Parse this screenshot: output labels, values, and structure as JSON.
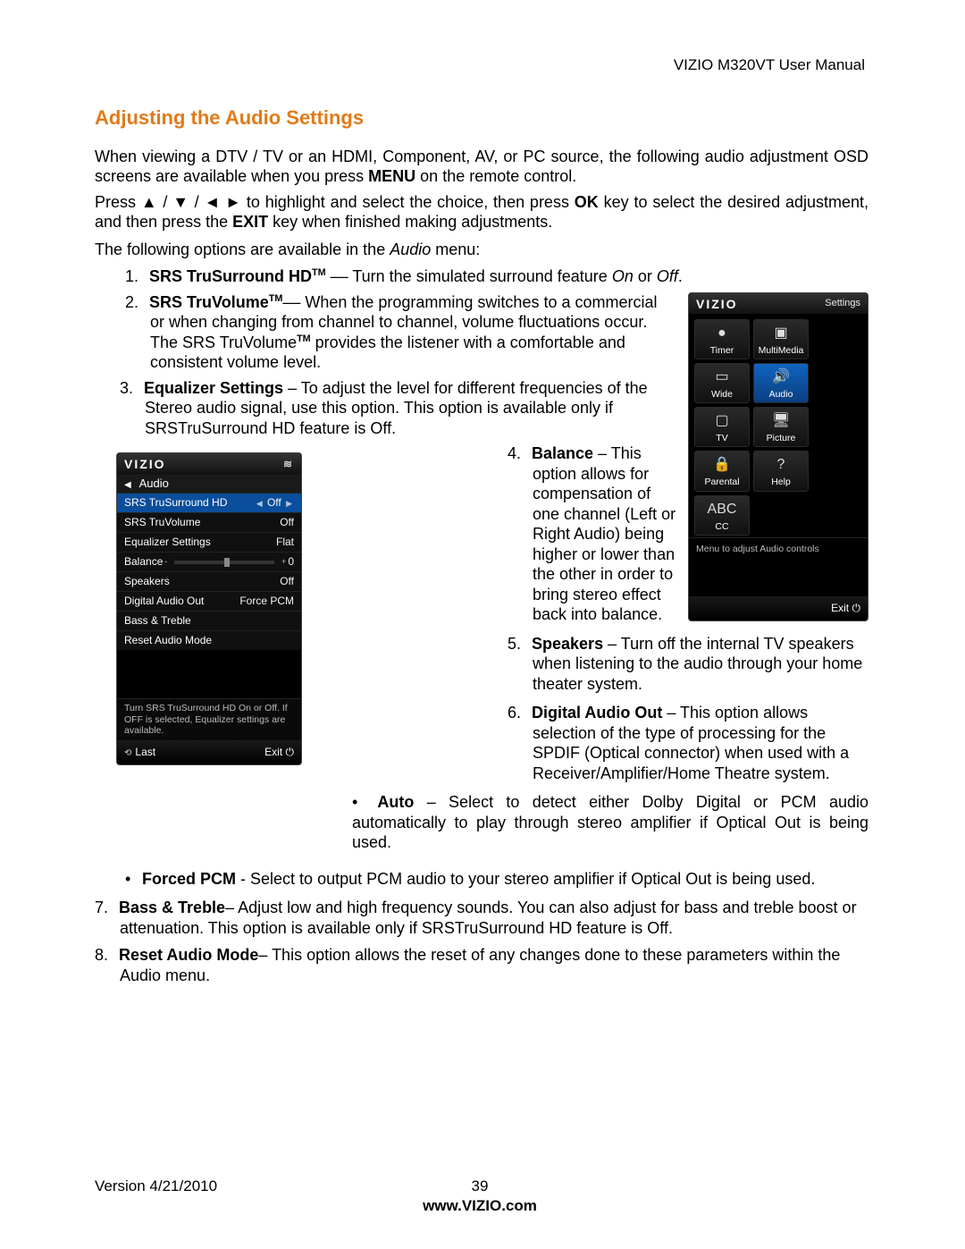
{
  "doc": {
    "header": "VIZIO M320VT User Manual",
    "title": "Adjusting the Audio Settings",
    "intro1a": "When viewing a DTV / TV or an HDMI, Component, AV, or PC source, the following audio adjustment OSD screens are available when you press ",
    "intro1b": "MENU",
    "intro1c": " on the remote control.",
    "intro2a": "Press  ▲  /  ▼  /  ◄    ►  to highlight and select the choice, then press ",
    "intro2b": "OK",
    "intro2c": " key to select the desired adjustment, and then press the ",
    "intro2d": "EXIT",
    "intro2e": " key when finished making adjustments.",
    "intro3a": "The following options are available in the ",
    "intro3b": "Audio",
    "intro3c": " menu:",
    "li1": {
      "n": "1.",
      "b": "SRS TruSurround HD",
      "tm": "TM",
      "dash": " –– ",
      "t": "Turn the simulated surround feature ",
      "i1": "On",
      "mid": " or ",
      "i2": "Off",
      "end": "."
    },
    "li2": {
      "n": "2.",
      "b": "SRS TruVolume",
      "tm": "TM",
      "dash": "–– ",
      "t": "When the programming switches to a commercial or when changing from channel to channel, volume fluctuations occur. The SRS TruVolume",
      "tm2": "TM",
      "t2": "  provides the listener with a comfortable and consistent volume level."
    },
    "li3": {
      "n": "3.",
      "b": "Equalizer Settings",
      "dash": " – ",
      "t": "To adjust the level for different frequencies of the Stereo audio signal, use this option. This option is available only if SRSTruSurround HD feature is Off."
    },
    "li4": {
      "n": "4.",
      "b": "Balance",
      "dash": " – ",
      "t": "This option allows for compensation of one channel (Left or Right Audio) being higher or lower than the other in order to bring stereo effect back into balance."
    },
    "li5": {
      "n": "5.",
      "b": "Speakers",
      "dash": " – ",
      "t": "Turn off the internal TV speakers when listening to the audio through your home theater system."
    },
    "li6": {
      "n": "6.",
      "b": "Digital Audio Out",
      "dash": " – ",
      "t": "This option allows selection of the type of processing for the SPDIF (Optical connector) when used with a Receiver/Amplifier/Home Theatre system."
    },
    "li6a": {
      "b": "Auto",
      "dash": " – ",
      "t": "Select to detect either Dolby Digital or PCM audio automatically to play through stereo amplifier if Optical Out is being used."
    },
    "li6b": {
      "b": "Forced PCM",
      "dash": " - ",
      "t": "Select to output PCM audio to your stereo amplifier if Optical Out is being used."
    },
    "li7": {
      "n": " 7.",
      "b": "Bass & Treble",
      "dash": "– ",
      "t": "Adjust low and high frequency sounds. You can also adjust for bass and treble boost or attenuation. This option is available only if SRSTruSurround HD feature is Off."
    },
    "li8": {
      "n": "8.",
      "b": "Reset Audio ",
      "b2": "Mode",
      "dash": "– ",
      "t": "This option allows the reset of any changes done to these parameters within the Audio menu."
    },
    "footer": {
      "version": "Version 4/21/2010",
      "page": "39",
      "site": "www.VIZIO.com"
    }
  },
  "osd_audio": {
    "brand": "VIZIO",
    "wifi": "≋",
    "subtitle": "Audio",
    "tri": "◀",
    "rows": [
      {
        "label": "SRS TruSurround HD",
        "value": "Off",
        "sel": true,
        "arrows": true
      },
      {
        "label": "SRS TruVolume",
        "value": "Off"
      },
      {
        "label": "Equalizer Settings",
        "value": "Flat"
      },
      {
        "label": "Balance",
        "value": "0",
        "slider": true
      },
      {
        "label": "Speakers",
        "value": "Off"
      },
      {
        "label": "Digital Audio Out",
        "value": "Force PCM"
      },
      {
        "label": "Bass & Treble",
        "value": ""
      },
      {
        "label": "Reset Audio Mode",
        "value": ""
      }
    ],
    "hint": "Turn SRS TruSurround HD On or Off. If OFF is selected, Equalizer settings are available.",
    "last_label": "Last",
    "last_icon": "⟲",
    "exit_label": "Exit",
    "exit_icon": "⏻"
  },
  "osd_settings": {
    "brand": "VIZIO",
    "label": "Settings",
    "cells": [
      {
        "name": "Timer",
        "icon": "●"
      },
      {
        "name": "MultiMedia",
        "icon": "▣"
      },
      {
        "name": "Wide",
        "icon": "▭"
      },
      {
        "name": "Audio",
        "icon": "🔊",
        "sel": true
      },
      {
        "name": "TV",
        "icon": "▢"
      },
      {
        "name": "Picture",
        "icon": "🖥"
      },
      {
        "name": "Parental",
        "icon": "🔒"
      },
      {
        "name": "Help",
        "icon": "?"
      },
      {
        "name": "CC",
        "icon": "ABC"
      }
    ],
    "hint": "Menu to adjust Audio controls",
    "exit_label": "Exit",
    "exit_icon": "⏻"
  }
}
